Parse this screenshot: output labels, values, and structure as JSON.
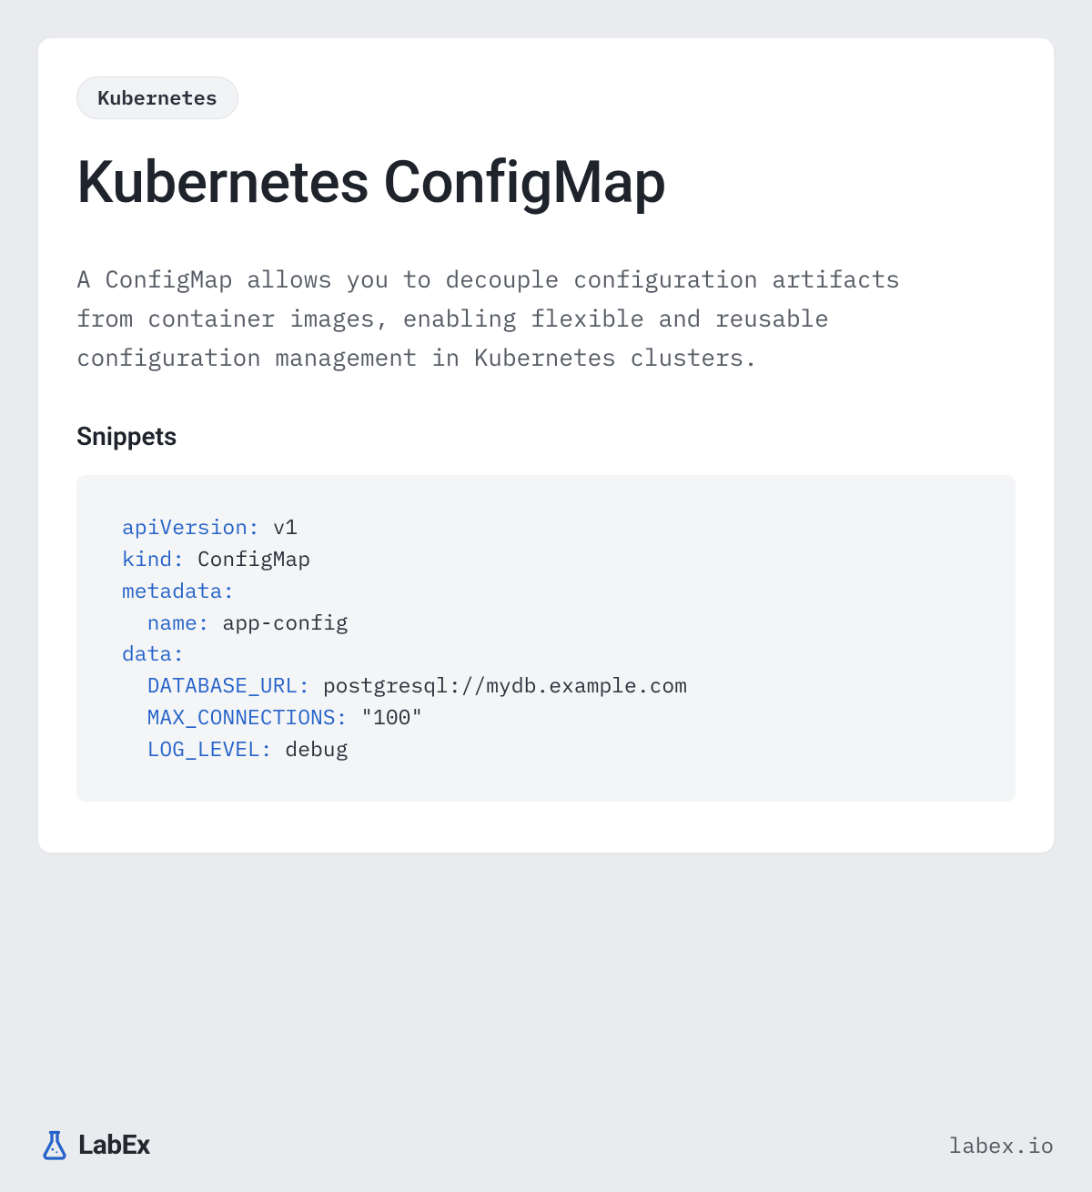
{
  "tag": "Kubernetes",
  "title": "Kubernetes ConfigMap",
  "description": "A ConfigMap allows you to decouple configuration artifacts from container images, enabling flexible and reusable configuration management in Kubernetes clusters.",
  "snippets_heading": "Snippets",
  "code": {
    "lines": [
      {
        "key": "apiVersion:",
        "value": " v1",
        "indent": 0
      },
      {
        "key": "kind:",
        "value": " ConfigMap",
        "indent": 0
      },
      {
        "key": "metadata:",
        "value": "",
        "indent": 0
      },
      {
        "key": "name:",
        "value": " app-config",
        "indent": 1
      },
      {
        "key": "data:",
        "value": "",
        "indent": 0
      },
      {
        "key": "DATABASE_URL:",
        "value": " postgresql://mydb.example.com",
        "indent": 1
      },
      {
        "key": "MAX_CONNECTIONS:",
        "value": " \"100\"",
        "indent": 1
      },
      {
        "key": "LOG_LEVEL:",
        "value": " debug",
        "indent": 1
      }
    ]
  },
  "brand": {
    "name": "LabEx",
    "url": "labex.io",
    "icon_color": "#2563c9"
  }
}
